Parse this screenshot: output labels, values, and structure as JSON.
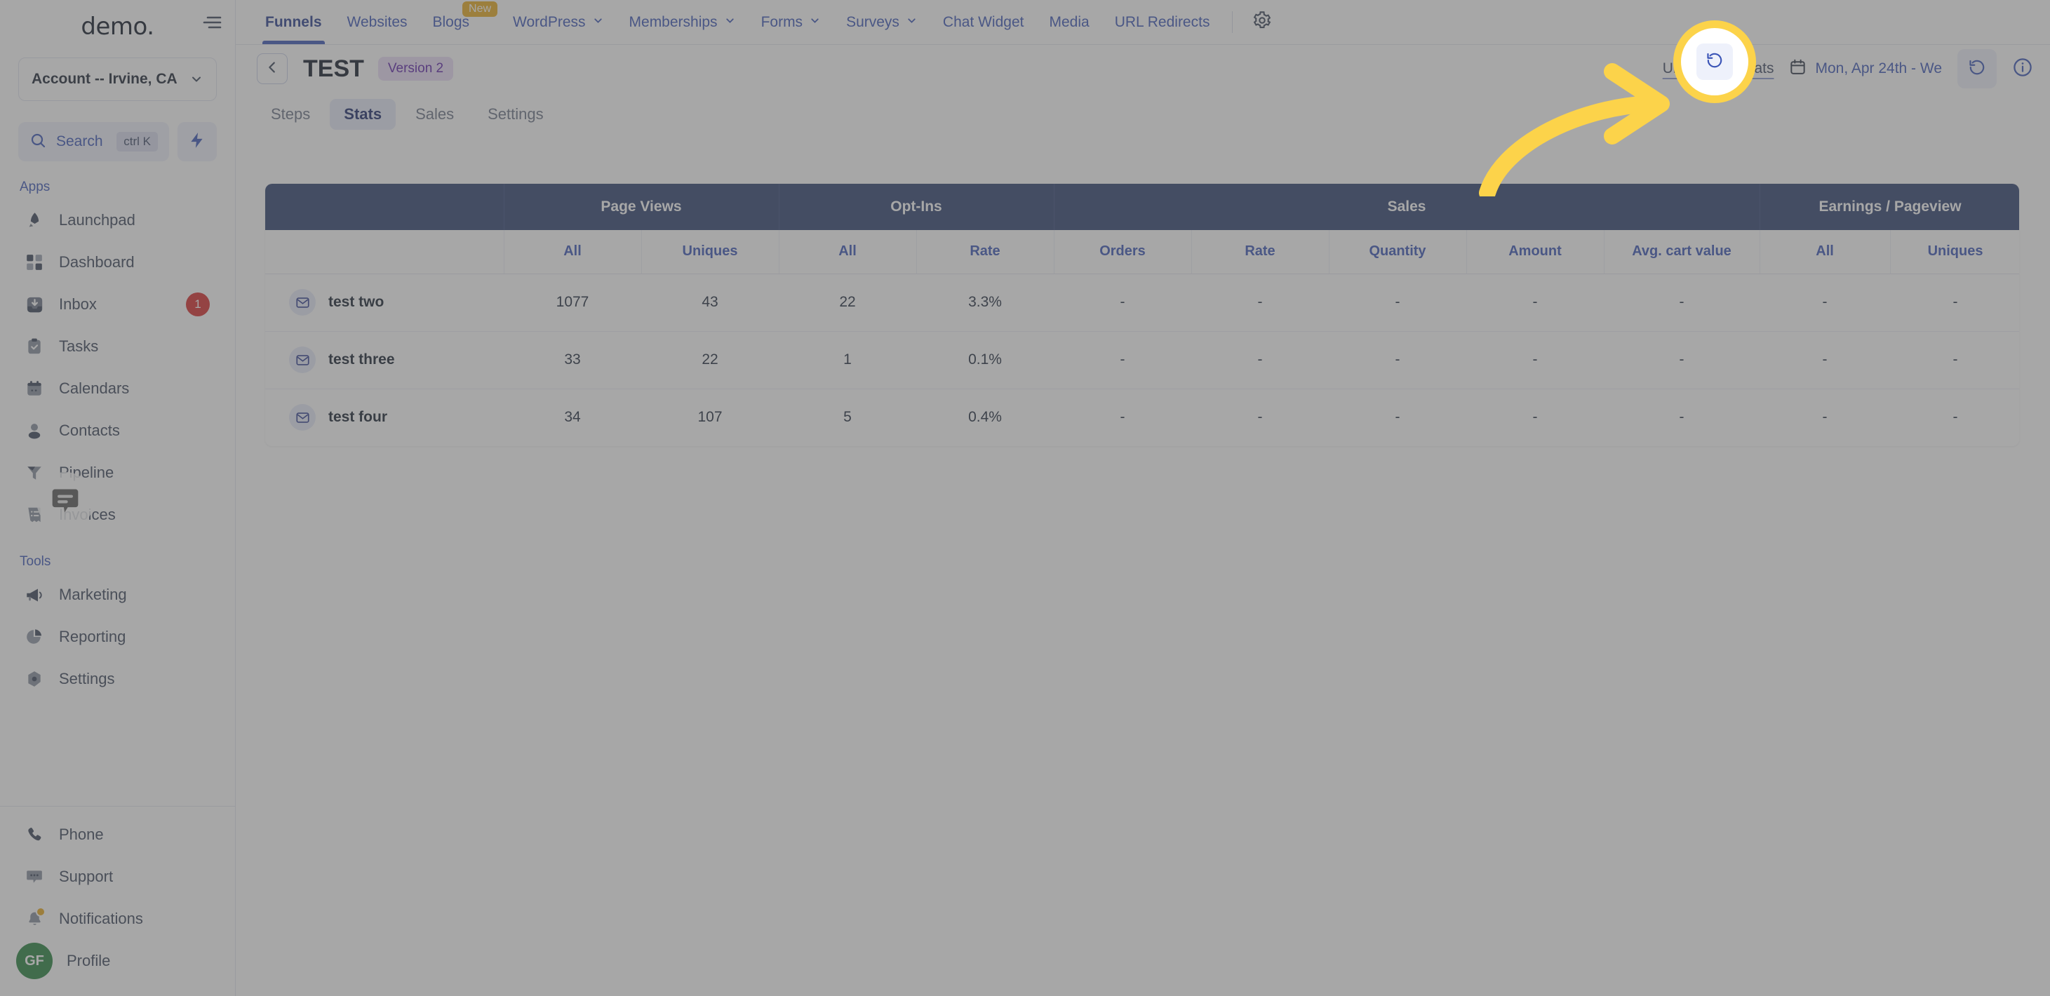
{
  "brand": {
    "logo_text": "demo",
    "logo_dot": "."
  },
  "sidebar": {
    "account_selector": {
      "label": "Account -- Irvine, CA",
      "icon": "chevron-down-icon"
    },
    "search": {
      "label": "Search",
      "shortcut": "ctrl K",
      "icon": "search-icon"
    },
    "quick_action_icon": "bolt-icon",
    "sections": [
      {
        "label": "Apps",
        "items": [
          {
            "label": "Launchpad",
            "icon": "rocket-icon",
            "badge": null
          },
          {
            "label": "Dashboard",
            "icon": "grid-icon",
            "badge": null
          },
          {
            "label": "Inbox",
            "icon": "inbox-icon",
            "badge": "1"
          },
          {
            "label": "Tasks",
            "icon": "clipboard-check-icon",
            "badge": null
          },
          {
            "label": "Calendars",
            "icon": "calendar-icon",
            "badge": null
          },
          {
            "label": "Contacts",
            "icon": "user-icon",
            "badge": null
          },
          {
            "label": "Pipeline",
            "icon": "funnel-icon",
            "badge": null
          },
          {
            "label": "Invoices",
            "icon": "invoice-icon",
            "badge": null
          }
        ]
      },
      {
        "label": "Tools",
        "items": [
          {
            "label": "Marketing",
            "icon": "megaphone-icon",
            "badge": null
          },
          {
            "label": "Reporting",
            "icon": "pie-chart-icon",
            "badge": null
          },
          {
            "label": "Settings",
            "icon": "gear-hex-icon",
            "badge": null
          }
        ]
      }
    ],
    "bottom_items": [
      {
        "label": "Phone",
        "icon": "phone-icon"
      },
      {
        "label": "Support",
        "icon": "chat-dots-icon"
      },
      {
        "label": "Notifications",
        "icon": "bell-icon"
      },
      {
        "label": "Profile",
        "icon": "avatar",
        "avatar_initials": "GF"
      }
    ]
  },
  "topnav": {
    "menu_icon": "hamburger-icon",
    "items": [
      {
        "label": "Funnels",
        "active": true,
        "caret": false,
        "badge": null
      },
      {
        "label": "Websites",
        "active": false,
        "caret": false,
        "badge": null
      },
      {
        "label": "Blogs",
        "active": false,
        "caret": false,
        "badge": "New"
      },
      {
        "label": "WordPress",
        "active": false,
        "caret": true,
        "badge": null
      },
      {
        "label": "Memberships",
        "active": false,
        "caret": true,
        "badge": null
      },
      {
        "label": "Forms",
        "active": false,
        "caret": true,
        "badge": null
      },
      {
        "label": "Surveys",
        "active": false,
        "caret": true,
        "badge": null
      },
      {
        "label": "Chat Widget",
        "active": false,
        "caret": false,
        "badge": null
      },
      {
        "label": "Media",
        "active": false,
        "caret": false,
        "badge": null
      },
      {
        "label": "URL Redirects",
        "active": false,
        "caret": false,
        "badge": null
      }
    ],
    "settings_icon": "gear-icon"
  },
  "page_header": {
    "back_icon": "chevron-left-icon",
    "title": "TEST",
    "version_badge": "Version 2",
    "understand_stats": "Understand stats",
    "calendar_icon": "calendar-icon",
    "date_range": "Mon, Apr 24th - We",
    "refresh_icon": "refresh-ccw-icon",
    "info_icon": "info-circle-icon"
  },
  "subtabs": [
    {
      "label": "Steps",
      "active": false
    },
    {
      "label": "Stats",
      "active": true
    },
    {
      "label": "Sales",
      "active": false
    },
    {
      "label": "Settings",
      "active": false
    }
  ],
  "stats_table": {
    "group_headers": [
      {
        "label": "",
        "span": 1
      },
      {
        "label": "Page Views",
        "span": 2
      },
      {
        "label": "Opt-Ins",
        "span": 2
      },
      {
        "label": "Sales",
        "span": 5
      },
      {
        "label": "Earnings / Pageview",
        "span": 2
      }
    ],
    "sub_headers": [
      "",
      "All",
      "Uniques",
      "All",
      "Rate",
      "Orders",
      "Rate",
      "Quantity",
      "Amount",
      "Avg. cart value",
      "All",
      "Uniques"
    ],
    "rows": [
      {
        "icon": "mail-icon",
        "name": "test two",
        "values": [
          "1077",
          "43",
          "22",
          "3.3%",
          "-",
          "-",
          "-",
          "-",
          "-",
          "-",
          "-"
        ]
      },
      {
        "icon": "mail-icon",
        "name": "test three",
        "values": [
          "33",
          "22",
          "1",
          "0.1%",
          "-",
          "-",
          "-",
          "-",
          "-",
          "-",
          "-"
        ]
      },
      {
        "icon": "mail-icon",
        "name": "test four",
        "values": [
          "34",
          "107",
          "5",
          "0.4%",
          "-",
          "-",
          "-",
          "-",
          "-",
          "-",
          "-"
        ]
      }
    ]
  },
  "annotation": {
    "type": "arrow-and-spotlight",
    "target": "refresh-button",
    "arrow_color": "#FCD34A",
    "spotlight_color": "#FCD34A"
  },
  "colors": {
    "table_header_bg": "#2E4070",
    "accent_blue": "#3B55B7",
    "badge_red": "#D62B2B",
    "badge_new": "#E8AB1F",
    "version_badge_bg": "#E9DDF7",
    "version_badge_fg": "#5B21A8",
    "avatar_green": "#27833E"
  }
}
